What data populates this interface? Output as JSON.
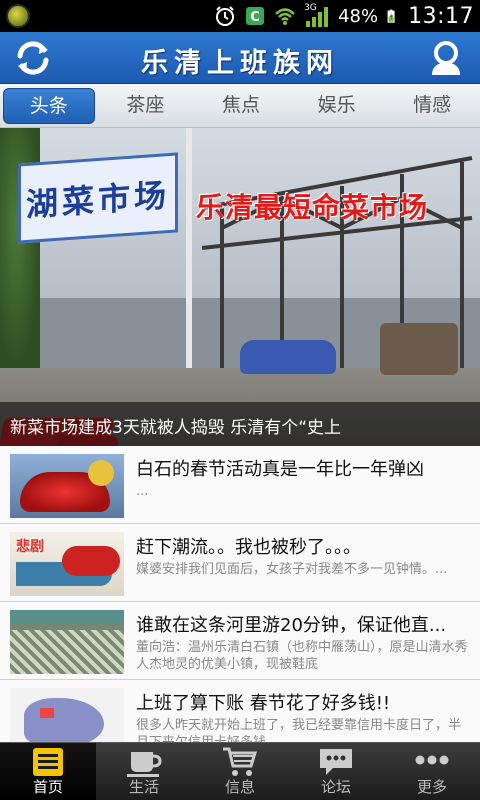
{
  "status_bar": {
    "signal_label": "3G",
    "battery": "48%",
    "time": "13:17"
  },
  "header": {
    "title": "乐清上班族网",
    "refresh_icon": "refresh-icon",
    "user_icon": "user-icon",
    "accent_color": "#1c5ab0"
  },
  "tabs": [
    {
      "label": "头条",
      "active": true
    },
    {
      "label": "茶座",
      "active": false
    },
    {
      "label": "焦点",
      "active": false
    },
    {
      "label": "娱乐",
      "active": false
    },
    {
      "label": "情感",
      "active": false
    }
  ],
  "hero": {
    "sign_left_text": "湖菜市场",
    "sign_right_text": "乐清最短命菜市场",
    "caption": "新菜市场建成3天就被人捣毁 乐清有个“史上"
  },
  "news": [
    {
      "headline": "白石的春节活动真是一年比一年弹凶",
      "summary": "...",
      "thumb_text": ""
    },
    {
      "headline": "赶下潮流。。我也被秒了。。。",
      "summary": "媒婆安排我们见面后，女孩子对我差不多一见钟情。...",
      "thumb_text": "悲剧"
    },
    {
      "headline": "谁敢在这条河里游20分钟，保证他直...",
      "summary": "董向浩：温州乐清白石镇（也称中雁荡山），原是山清水秀人杰地灵的优美小镇，现被鞋底",
      "thumb_text": ""
    },
    {
      "headline": "上班了算下账 春节花了好多钱!!",
      "summary": "很多人昨天就开始上班了，我已经要靠信用卡度日了，半月下来欠信用卡好多钱",
      "thumb_text": ""
    }
  ],
  "bottom_nav": [
    {
      "label": "首页",
      "icon": "home-icon",
      "active": true
    },
    {
      "label": "生活",
      "icon": "coffee-icon",
      "active": false
    },
    {
      "label": "信息",
      "icon": "cart-icon",
      "active": false
    },
    {
      "label": "论坛",
      "icon": "chat-icon",
      "active": false
    },
    {
      "label": "更多",
      "icon": "more-icon",
      "active": false
    }
  ]
}
